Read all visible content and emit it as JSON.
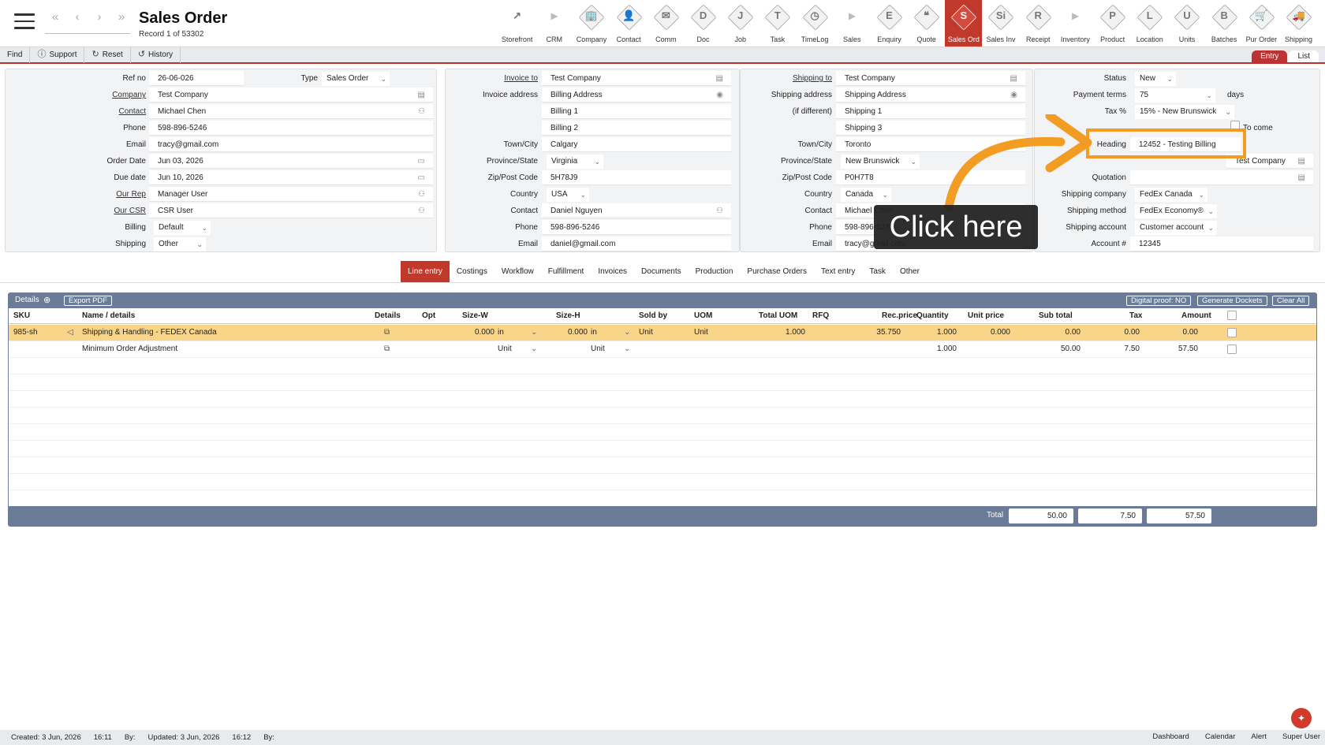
{
  "header": {
    "title": "Sales Order",
    "record_info": "Record 1 of 53302"
  },
  "record_nav": [
    "«",
    "‹",
    "›",
    "»"
  ],
  "modules": [
    {
      "label": "Storefront",
      "glyph": "↗",
      "kind": "plain"
    },
    {
      "label": "CRM",
      "glyph": "▸",
      "kind": "sep"
    },
    {
      "label": "Company",
      "glyph": "🏢",
      "kind": "icon"
    },
    {
      "label": "Contact",
      "glyph": "👤",
      "kind": "icon"
    },
    {
      "label": "Comm",
      "glyph": "✉",
      "kind": "icon"
    },
    {
      "label": "Doc",
      "glyph": "D",
      "kind": "icon"
    },
    {
      "label": "Job",
      "glyph": "J",
      "kind": "icon"
    },
    {
      "label": "Task",
      "glyph": "T",
      "kind": "icon"
    },
    {
      "label": "TimeLog",
      "glyph": "◷",
      "kind": "icon"
    },
    {
      "label": "Sales",
      "glyph": "▸",
      "kind": "sep"
    },
    {
      "label": "Enquiry",
      "glyph": "E",
      "kind": "icon"
    },
    {
      "label": "Quote",
      "glyph": "❝",
      "kind": "icon"
    },
    {
      "label": "Sales Ord",
      "glyph": "S",
      "kind": "icon",
      "active": true
    },
    {
      "label": "Sales Inv",
      "glyph": "Si",
      "kind": "icon"
    },
    {
      "label": "Receipt",
      "glyph": "R",
      "kind": "icon"
    },
    {
      "label": "Inventory",
      "glyph": "▸",
      "kind": "sep"
    },
    {
      "label": "Product",
      "glyph": "P",
      "kind": "icon"
    },
    {
      "label": "Location",
      "glyph": "L",
      "kind": "icon"
    },
    {
      "label": "Units",
      "glyph": "U",
      "kind": "icon"
    },
    {
      "label": "Batches",
      "glyph": "B",
      "kind": "icon"
    },
    {
      "label": "Pur Order",
      "glyph": "🛒",
      "kind": "icon"
    },
    {
      "label": "Shipping",
      "glyph": "🚚",
      "kind": "icon"
    }
  ],
  "toolbar": {
    "find": "Find",
    "support": "Support",
    "reset": "Reset",
    "history": "History"
  },
  "view_tabs": {
    "entry": "Entry",
    "list": "List"
  },
  "panel1": {
    "ref_label": "Ref no",
    "ref": "26-06-026",
    "type_label": "Type",
    "type": "Sales Order",
    "company_label": "Company",
    "company": "Test Company",
    "contact_label": "Contact",
    "contact": "Michael Chen",
    "phone_label": "Phone",
    "phone": "598-896-5246",
    "email_label": "Email",
    "email": "tracy@gmail.com",
    "order_date_label": "Order Date",
    "order_date": "Jun 03, 2026",
    "due_date_label": "Due date",
    "due_date": "Jun 10, 2026",
    "rep_label": "Our Rep",
    "rep": "Manager User",
    "csr_label": "Our CSR",
    "csr": "CSR User",
    "billing_label": "Billing",
    "billing": "Default",
    "shipping_label": "Shipping",
    "shipping": "Other"
  },
  "panel2": {
    "invoice_to_label": "Invoice to",
    "invoice_to": "Test Company",
    "invoice_address_label": "Invoice address",
    "address1": "Billing Address",
    "address2": "Billing 1",
    "address3": "Billing 2",
    "town_label": "Town/City",
    "town": "Calgary",
    "province_label": "Province/State",
    "province": "Virginia",
    "zip_label": "Zip/Post Code",
    "zip": "5H78J9",
    "country_label": "Country",
    "country": "USA",
    "contact_label": "Contact",
    "contact": "Daniel Nguyen",
    "phone_label": "Phone",
    "phone": "598-896-5246",
    "email_label": "Email",
    "email": "daniel@gmail.com"
  },
  "panel3": {
    "shipping_to_label": "Shipping to",
    "shipping_to": "Test Company",
    "shipping_address_label": "Shipping address",
    "if_different_label": "(if different)",
    "address1": "Shipping Address",
    "address2": "Shipping 1",
    "address3": "Shipping 3",
    "town_label": "Town/City",
    "town": "Toronto",
    "province_label": "Province/State",
    "province": "New Brunswick",
    "zip_label": "Zip/Post Code",
    "zip": "P0H7T8",
    "country_label": "Country",
    "country": "Canada",
    "contact_label": "Contact",
    "contact": "Michael Chen",
    "phone_label": "Phone",
    "phone": "598-896-5246",
    "email_label": "Email",
    "email": "tracy@gmail.com"
  },
  "panel4": {
    "status_label": "Status",
    "status": "New",
    "payment_terms_label": "Payment terms",
    "payment_terms": "75",
    "days": "days",
    "tax_label": "Tax %",
    "tax": "15% - New Brunswick",
    "to_come": "To come",
    "heading_label": "Heading",
    "heading": "12452 - Testing Billing",
    "company_partial": "Test Company",
    "quotation_label": "Quotation",
    "shipping_company_label": "Shipping company",
    "shipping_company": "FedEx Canada",
    "shipping_method_label": "Shipping method",
    "shipping_method": "FedEx Economy®",
    "shipping_account_label": "Shipping account",
    "shipping_account": "Customer account",
    "account_label": "Account #",
    "account": "12345"
  },
  "subtabs": [
    "Line entry",
    "Costings",
    "Workflow",
    "Fulfillment",
    "Invoices",
    "Documents",
    "Production",
    "Purchase Orders",
    "Text entry",
    "Task",
    "Other"
  ],
  "grid": {
    "details_label": "Details",
    "export_pdf": "Export PDF",
    "digital_proof": "Digital proof: NO",
    "generate_dockets": "Generate Dockets",
    "clear_all": "Clear All",
    "columns": [
      "SKU",
      "Name / details",
      "Details",
      "Opt",
      "Size-W",
      "Size-H",
      "Sold by",
      "UOM",
      "Total UOM",
      "RFQ",
      "Rec.price",
      "Quantity",
      "Unit price",
      "Sub total",
      "Tax",
      "Amount"
    ],
    "rows": [
      {
        "sku": "985-sh",
        "name": "Shipping & Handling - FEDEX Canada",
        "size_w": "0.000",
        "size_w_unit": "in",
        "size_h": "0.000",
        "size_h_unit": "in",
        "sold_by": "Unit",
        "uom": "Unit",
        "total_uom": "1.000",
        "rec_price": "35.750",
        "quantity": "1.000",
        "unit_price": "0.000",
        "sub_total": "0.00",
        "tax": "0.00",
        "amount": "0.00"
      },
      {
        "sku": "",
        "name": "Minimum Order Adjustment",
        "size_w": "",
        "size_w_unit": "Unit",
        "size_h": "",
        "size_h_unit": "Unit",
        "sold_by": "",
        "uom": "",
        "total_uom": "",
        "rec_price": "",
        "quantity": "1.000",
        "unit_price": "",
        "sub_total": "50.00",
        "tax": "7.50",
        "amount": "57.50"
      }
    ],
    "total_label": "Total",
    "total_sub": "50.00",
    "total_tax": "7.50",
    "total_amount": "57.50"
  },
  "status_bar": {
    "created": "Created: 3 Jun, 2026",
    "created_time": "16:11",
    "by1": "By:",
    "updated": "Updated: 3 Jun, 2026",
    "updated_time": "16:12",
    "by2": "By:",
    "links": [
      "Dashboard",
      "Calendar",
      "Alert",
      "Super User"
    ]
  },
  "callout": {
    "text": "Click here"
  },
  "colors": {
    "accent": "#c0392b",
    "grid_header": "#6b7c99",
    "highlight": "#f39c24",
    "selected_row": "#f9d58a"
  }
}
